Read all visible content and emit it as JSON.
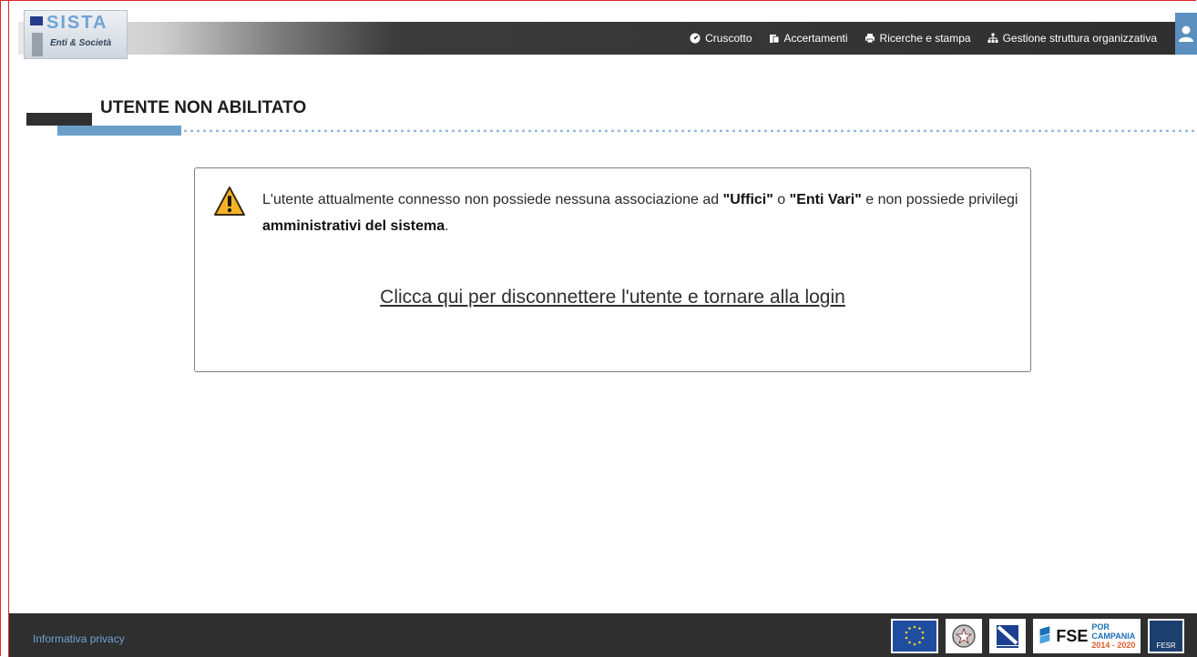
{
  "header": {
    "logo_title": "SISTA",
    "logo_subtitle": "Enti & Società",
    "nav": [
      {
        "label": "Cruscotto",
        "icon": "dashboard-icon"
      },
      {
        "label": "Accertamenti",
        "icon": "clipboard-icon"
      },
      {
        "label": "Ricerche e stampa",
        "icon": "printer-icon"
      },
      {
        "label": "Gestione struttura organizzativa",
        "icon": "org-chart-icon"
      }
    ],
    "user_icon": "user-icon"
  },
  "page": {
    "title": "UTENTE NON ABILITATO"
  },
  "message": {
    "part1": "L'utente attualmente connesso non possiede nessuna associazione ad ",
    "uffici": "\"Uffici\"",
    "part2": " o ",
    "enti": "\"Enti Vari\"",
    "part3": " e non possiede privilegi ",
    "admin": "amministrativi del sistema",
    "part4": ".",
    "link": "Clicca qui per disconnettere l'utente e tornare alla login"
  },
  "footer": {
    "privacy": "Informativa privacy",
    "fse_label": "FSE",
    "fse_sub1": "POR CAMPANIA",
    "fse_sub2": "2014 - 2020",
    "fesr_label": "FESR"
  },
  "colors": {
    "accent": "#6b9fc9",
    "header_dark": "#2f2f2f",
    "frame": "#e3262b"
  }
}
